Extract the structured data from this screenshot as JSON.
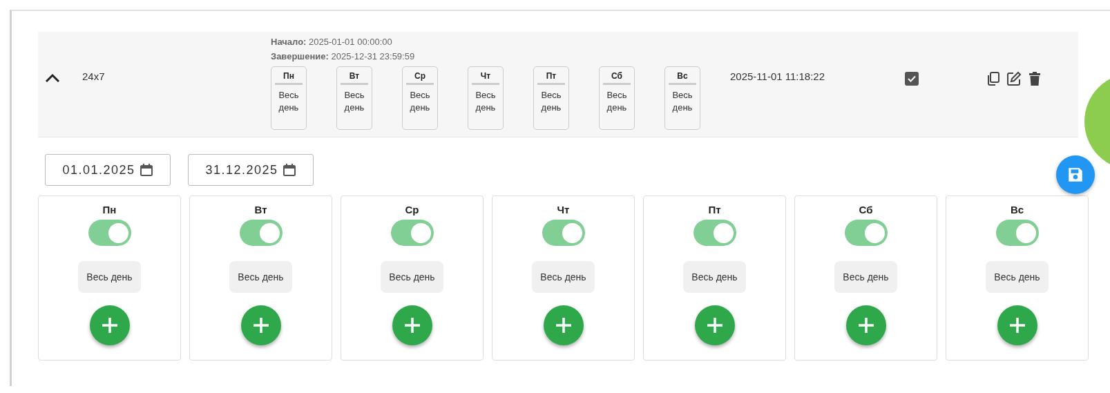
{
  "row": {
    "expanded": true,
    "name": "24x7",
    "start": "**Начало:** 2025-01-01 00:00:00",
    "end": "**Завершение:** 2025-12-31 23:59:59",
    "days": [
      {
        "label": "Пн",
        "text": "Весь день"
      },
      {
        "label": "Вт",
        "text": "Весь день"
      },
      {
        "label": "Ср",
        "text": "Весь день"
      },
      {
        "label": "Чт",
        "text": "Весь день"
      },
      {
        "label": "Пт",
        "text": "Весь день"
      },
      {
        "label": "Сб",
        "text": "Весь день"
      },
      {
        "label": "Вс",
        "text": "Весь день"
      }
    ],
    "created": "2025-11-01 11:18:22",
    "checked": true
  },
  "editor": {
    "start_date": "01.01.2025",
    "end_date": "31.12.2025",
    "days": [
      {
        "label": "Пн",
        "on": true,
        "slot": "Весь день"
      },
      {
        "label": "Вт",
        "on": true,
        "slot": "Весь день"
      },
      {
        "label": "Ср",
        "on": true,
        "slot": "Весь день"
      },
      {
        "label": "Чт",
        "on": true,
        "slot": "Весь день"
      },
      {
        "label": "Пт",
        "on": true,
        "slot": "Весь день"
      },
      {
        "label": "Сб",
        "on": true,
        "slot": "Весь день"
      },
      {
        "label": "Вс",
        "on": true,
        "slot": "Весь день"
      }
    ]
  }
}
